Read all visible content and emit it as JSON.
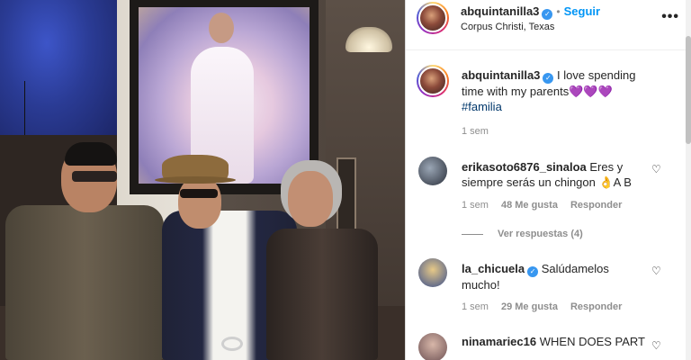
{
  "post": {
    "author": "abquintanilla3",
    "follow_label": "Seguir",
    "location": "Corpus Christi, Texas",
    "more_label": "•••"
  },
  "caption": {
    "author": "abquintanilla3",
    "text": "I love spending time with my parents",
    "hearts": "💜💜💜",
    "hashtag": "#familia",
    "time": "1 sem"
  },
  "comments": [
    {
      "author": "erikasoto6876_sinaloa",
      "text": "Eres y siempre serás un chingon 👌A B",
      "time": "1 sem",
      "likes": "48 Me gusta",
      "reply_label": "Responder",
      "view_replies": "Ver respuestas (4)",
      "avatar_colors": [
        "#2a2f3a",
        "#9aa6b5"
      ]
    },
    {
      "author": "la_chicuela",
      "text": "Salúdamelos mucho!",
      "time": "1 sem",
      "likes": "29 Me gusta",
      "reply_label": "Responder",
      "avatar_colors": [
        "#3a4f8c",
        "#e7c987"
      ]
    },
    {
      "author": "ninamariec16",
      "text": "WHEN DOES PART",
      "avatar_colors": [
        "#6b4f52",
        "#d8b7a9"
      ]
    }
  ],
  "colors": {
    "accent": "#0095f6",
    "verified": "#3897f0",
    "muted": "#8e8e8e",
    "hashtag": "#00376b"
  }
}
